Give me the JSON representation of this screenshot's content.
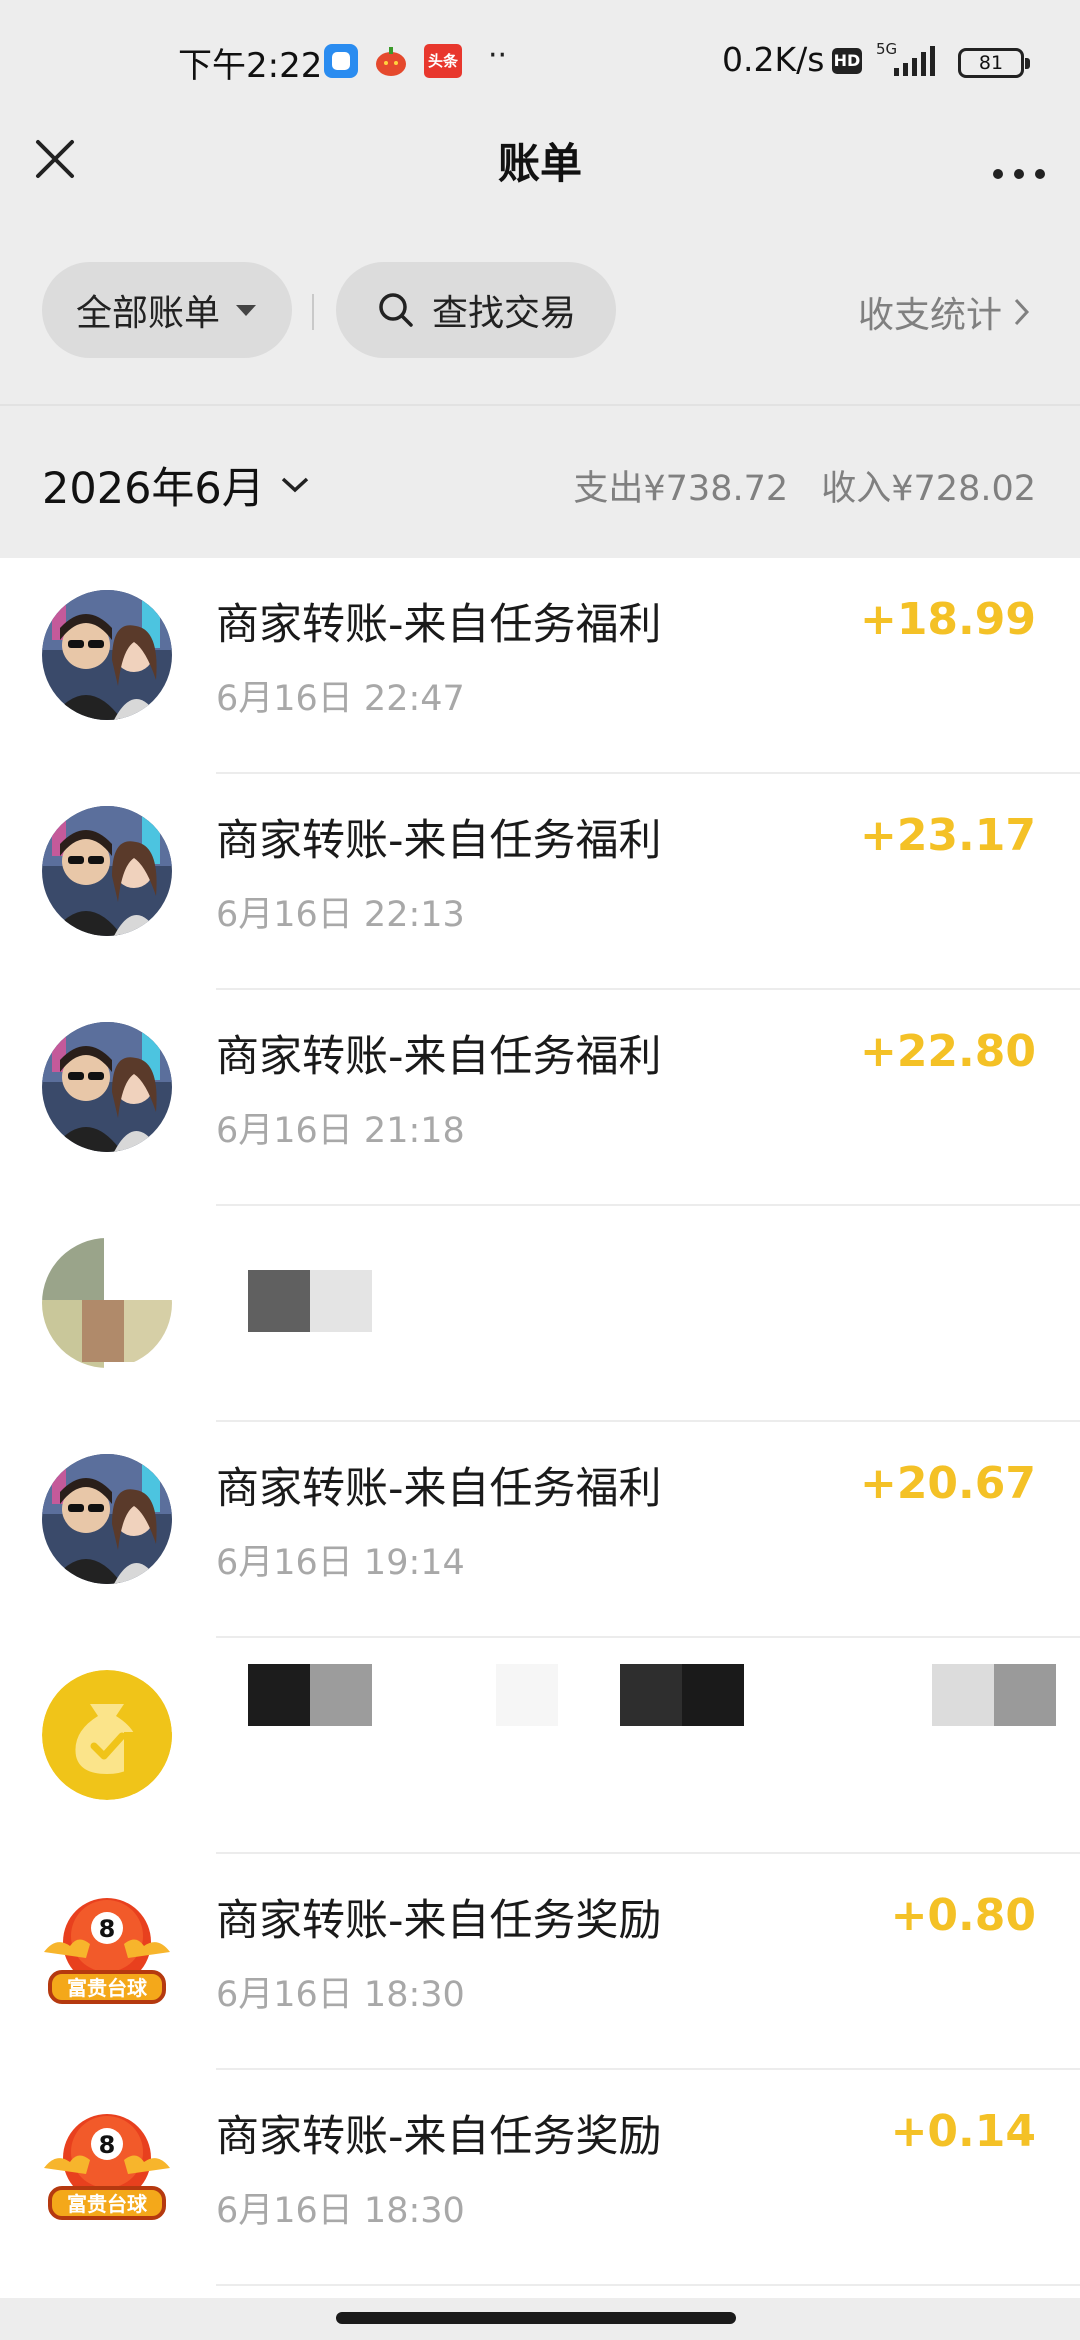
{
  "status_bar": {
    "time": "下午2:22",
    "app3_text": "头条",
    "dots": "··",
    "speed": "0.2K/s",
    "hd": "HD",
    "network": "5G",
    "battery": "81"
  },
  "header": {
    "title": "账单",
    "close_icon": "close-icon",
    "more_icon": "more-icon"
  },
  "filters": {
    "all_bills": "全部账单",
    "search": "查找交易",
    "stats": "收支统计"
  },
  "month": {
    "label": "2026年6月",
    "expense": "支出¥738.72",
    "income": "收入¥728.02"
  },
  "colors": {
    "accent_amount": "#f4c126",
    "background": "#ededed",
    "list_background": "#ffffff"
  },
  "transactions": [
    {
      "name": "商家转账-来自任务福利",
      "time": "6月16日 22:47",
      "amount": "+18.99",
      "avatar": "game-characters-avatar"
    },
    {
      "name": "商家转账-来自任务福利",
      "time": "6月16日 22:13",
      "amount": "+23.17",
      "avatar": "game-characters-avatar"
    },
    {
      "name": "商家转账-来自任务福利",
      "time": "6月16日 21:18",
      "amount": "+22.80",
      "avatar": "game-characters-avatar"
    },
    {
      "name": "",
      "time": "",
      "amount": "",
      "avatar": "pixelated-avatar"
    },
    {
      "name": "商家转账-来自任务福利",
      "time": "6月16日 19:14",
      "amount": "+20.67",
      "avatar": "game-characters-avatar"
    },
    {
      "name": "",
      "time": "",
      "amount": "",
      "avatar": "money-bag-avatar"
    },
    {
      "name": "商家转账-来自任务奖励",
      "time": "6月16日 18:30",
      "amount": "+0.80",
      "avatar": "billiards-avatar",
      "avatar_text": "富贵台球"
    },
    {
      "name": "商家转账-来自任务奖励",
      "time": "6月16日 18:30",
      "amount": "+0.14",
      "avatar": "billiards-avatar",
      "avatar_text": "富贵台球"
    }
  ]
}
